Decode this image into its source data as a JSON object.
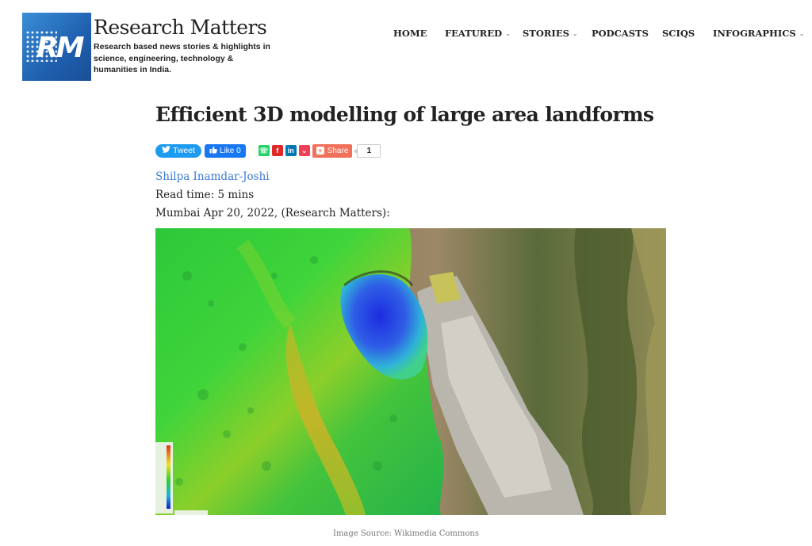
{
  "header": {
    "logo_text": "RM",
    "site_title": "Research Matters",
    "tagline": "Research based news stories & highlights in science, engineering, technology & humanities in India."
  },
  "nav": {
    "items": [
      {
        "label": "HOME",
        "has_dropdown": false
      },
      {
        "label": "FEATURED",
        "has_dropdown": true
      },
      {
        "label": "STORIES",
        "has_dropdown": true
      },
      {
        "label": "PODCASTS",
        "has_dropdown": false
      },
      {
        "label": "SCIQS",
        "has_dropdown": false
      },
      {
        "label": "INFOGRAPHICS",
        "has_dropdown": true
      }
    ],
    "dropdown_icon": "chevron-down-icon"
  },
  "article": {
    "title": "Efficient 3D modelling of large area landforms",
    "author": "Shilpa Inamdar-Joshi",
    "read_time": "Read time: 5 mins",
    "dateline": "Mumbai Apr 20, 2022, (Research Matters):",
    "image_caption": "Image Source: Wikimedia Commons"
  },
  "share": {
    "tweet_label": "Tweet",
    "like_label": "Like 0",
    "share_label": "Share",
    "share_count": "1",
    "icons": [
      "whatsapp-icon",
      "flipboard-icon",
      "linkedin-icon",
      "pocket-icon"
    ]
  },
  "colors": {
    "link": "#3a7bd5",
    "twitter": "#1d9bf0",
    "facebook": "#1877f2",
    "share": "#f0705a",
    "logo_blue": "#1e5fae"
  }
}
